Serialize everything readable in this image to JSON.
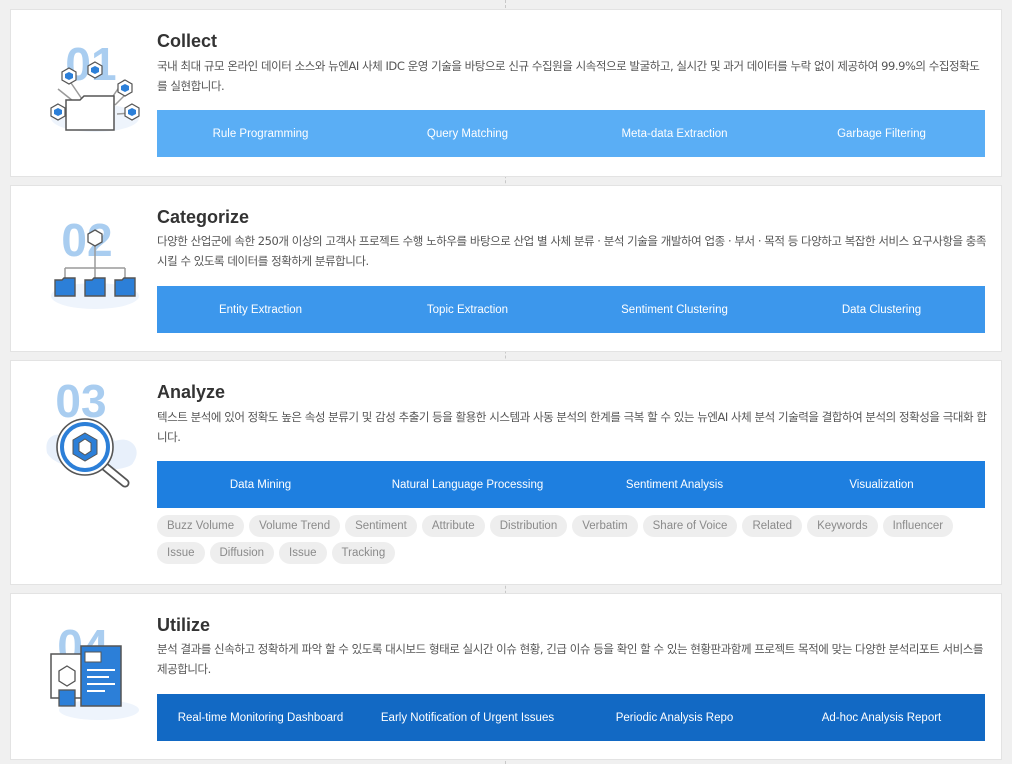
{
  "sections": [
    {
      "number": "01",
      "title": "Collect",
      "description": "국내 최대 규모 온라인 데이터 소스와 뉴엔AI 사체 IDC 운영 기술을 바탕으로 신규 수집원을 시속적으로 발굴하고, 실시간 및 과거 데이터를 누락 없이 제공하여 99.9%의 수집정확도를 실현합니다.",
      "bar": [
        "Rule Programming",
        "Query Matching",
        "Meta-data Extraction",
        "Garbage Filtering"
      ],
      "icon": "folder-network-icon"
    },
    {
      "number": "02",
      "title": "Categorize",
      "description": "다양한 산업군에 속한 250개 이상의 고객사 프로젝트 수행 노하우를 바탕으로 산업 별 사체 분류 · 분석 기술을 개발하여 업종 · 부서 · 목적 등 다양하고 복잡한 서비스 요구사항을 충족시킬 수 있도록 데이터를 정확하게 분류합니다.",
      "bar": [
        "Entity Extraction",
        "Topic Extraction",
        "Sentiment Clustering",
        "Data Clustering"
      ],
      "icon": "folder-tree-icon"
    },
    {
      "number": "03",
      "title": "Analyze",
      "description": "텍스트 분석에 있어 정확도 높은 속성 분류기 및 감성 추출기 등을 활용한 시스템과 사동 분석의 한계를 극복 할 수 있는 뉴엔AI 사체 분석 기술력을 결합하여 분석의 정확성을 극대화 합니다.",
      "bar": [
        "Data Mining",
        "Natural Language Processing",
        "Sentiment Analysis",
        "Visualization"
      ],
      "tags": [
        "Buzz Volume",
        "Volume Trend",
        "Sentiment",
        "Attribute",
        "Distribution",
        "Verbatim",
        "Share of Voice",
        "Related",
        "Keywords",
        "Influencer",
        "Issue",
        "Diffusion",
        "Issue",
        "Tracking"
      ],
      "icon": "magnifier-icon"
    },
    {
      "number": "04",
      "title": "Utilize",
      "description": "분석 결과를 신속하고 정확하게 파악 할 수 있도록 대시보드 형태로 실시간 이슈 현황, 긴급 이슈 등을 확인 할 수 있는 현황판과함께 프로젝트 목적에 맞는 다양한 분석리포트 서비스를 제공합니다.",
      "bar": [
        "Real-time Monitoring Dashboard",
        "Early Notification of Urgent Issues",
        "Periodic Analysis Repo",
        "Ad-hoc Analysis Report"
      ],
      "icon": "report-document-icon"
    }
  ],
  "colors": {
    "bar_1": "#5aaef5",
    "bar_2": "#3c97ec",
    "bar_3": "#1e7fe0",
    "bar_4": "#1269c4",
    "number": "#a9cdf0",
    "icon_blue": "#2c7fd8",
    "tag_bg": "#eeeeee"
  }
}
